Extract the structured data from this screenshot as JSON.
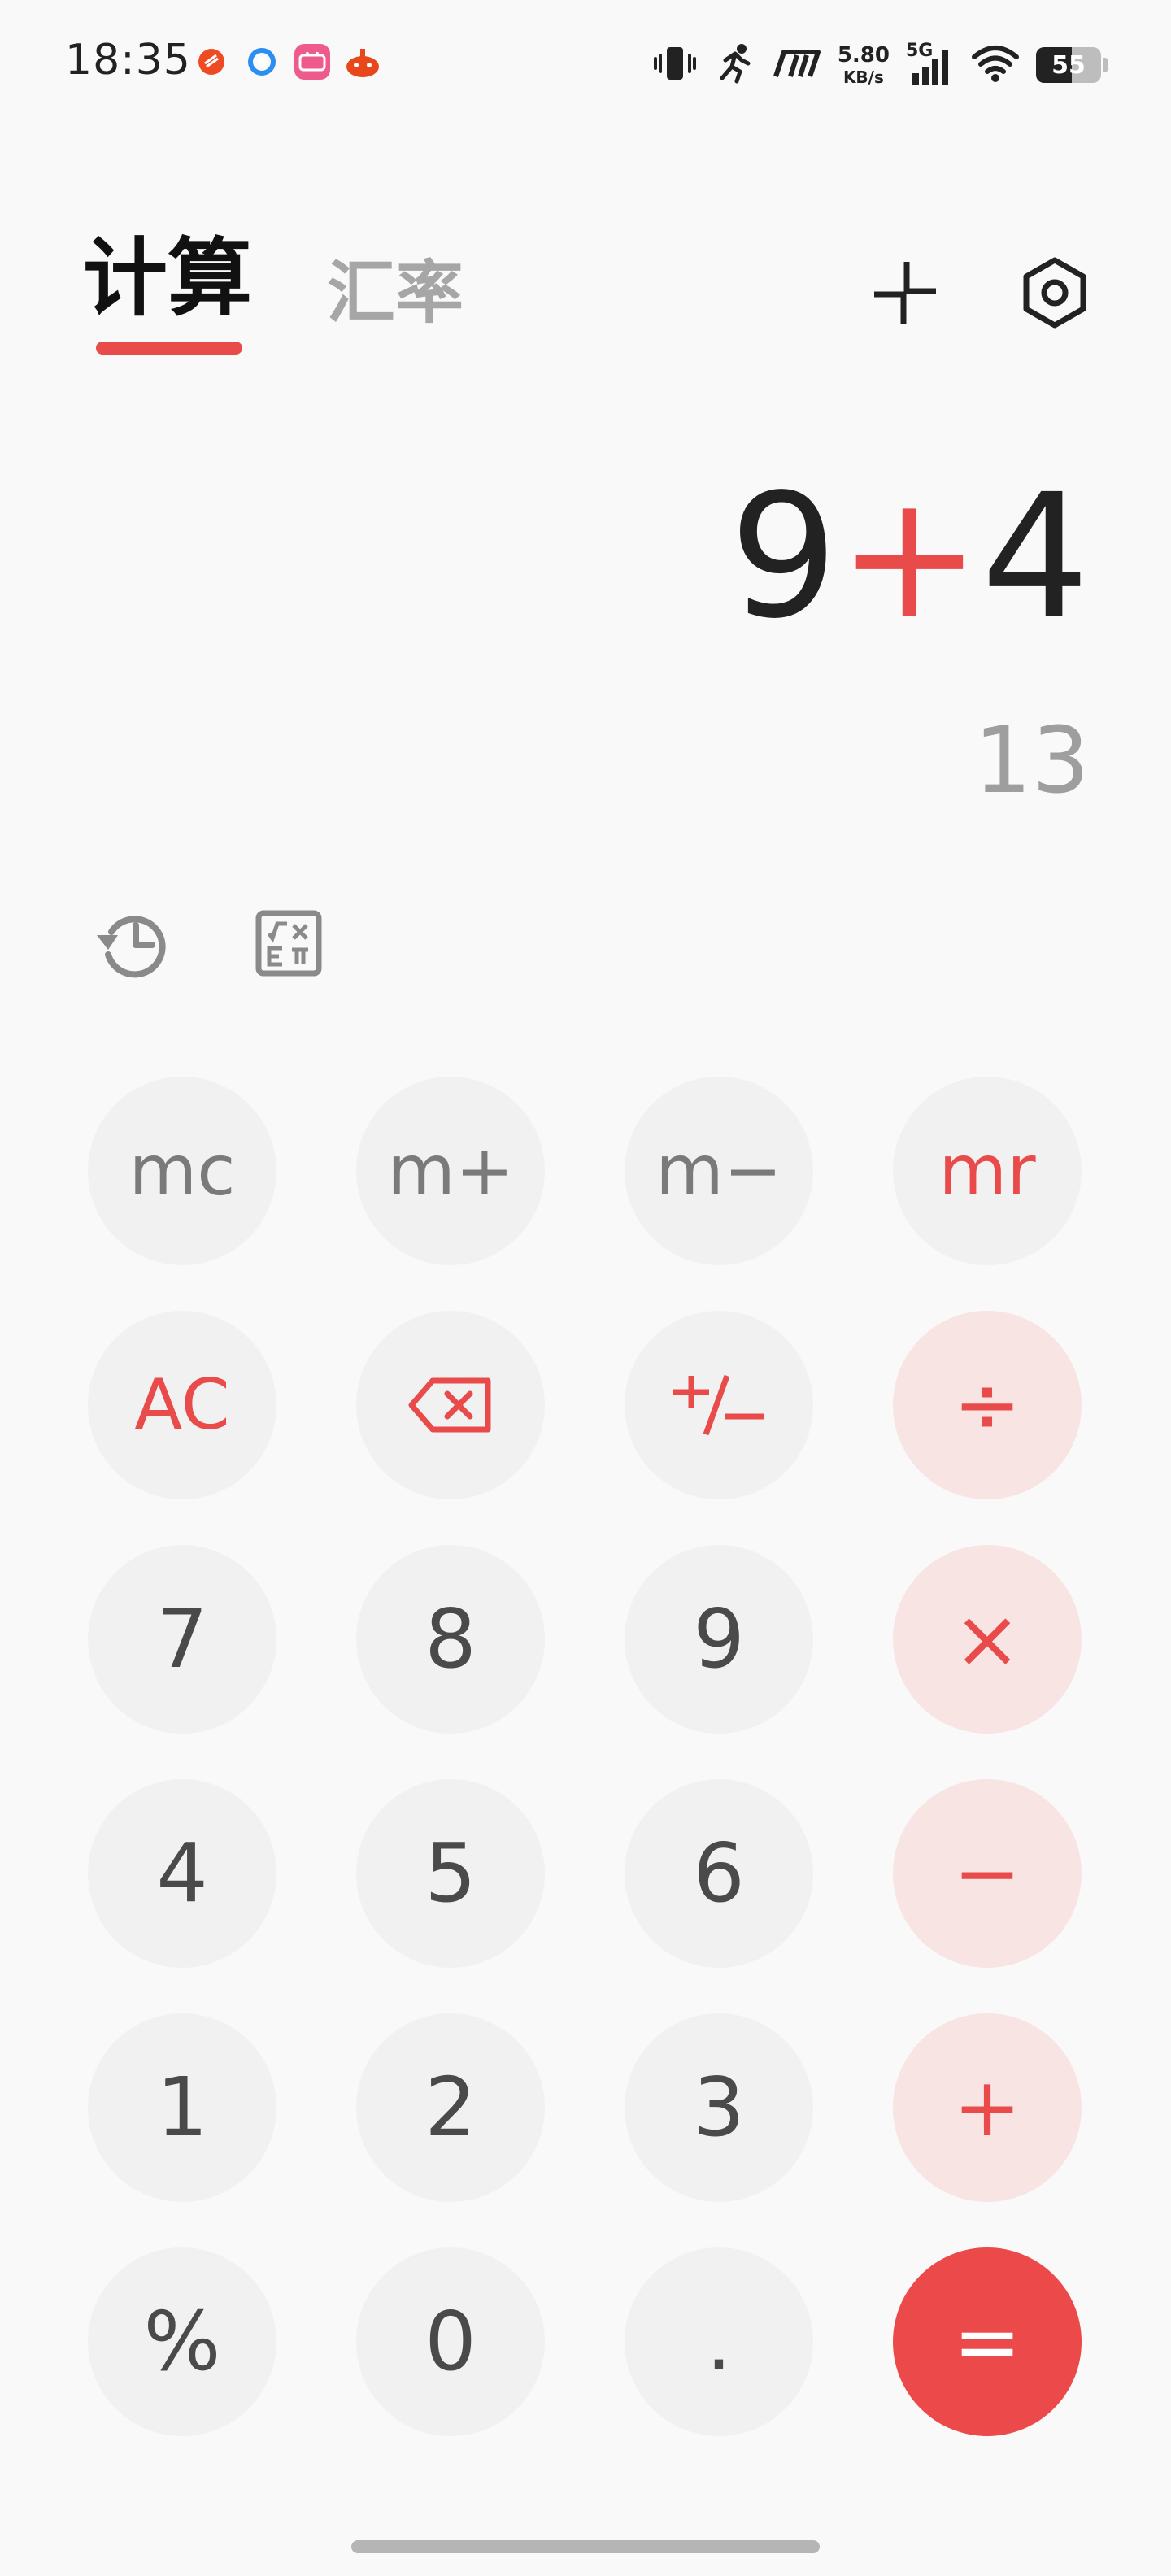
{
  "status_bar": {
    "time": "18:35",
    "net_speed_value": "5.80",
    "net_speed_unit": "KB/s",
    "network_type": "5G",
    "battery_level": "55",
    "notification_icons": [
      "sun-app-icon",
      "browser-app-icon",
      "bilibili-app-icon",
      "game-app-icon"
    ]
  },
  "header": {
    "tab_calc": "计算",
    "tab_rate": "汇率",
    "active_tab": "计算"
  },
  "display": {
    "operand1": "9",
    "operator": "+",
    "operand2": "4",
    "result": "13"
  },
  "keypad": {
    "row1": [
      "mc",
      "m+",
      "m−",
      "mr"
    ],
    "row2": [
      "AC",
      "⌫",
      "+/−",
      "÷"
    ],
    "row3": [
      "7",
      "8",
      "9",
      "×"
    ],
    "row4": [
      "4",
      "5",
      "6",
      "−"
    ],
    "row5": [
      "1",
      "2",
      "3",
      "+"
    ],
    "row6": [
      "%",
      "0",
      ".",
      "="
    ]
  },
  "colors": {
    "accent": "#e94b4b",
    "key_bg": "#f1f1f1",
    "op_key_bg": "#f9e4e4",
    "equals_bg": "#ec4a4a",
    "background": "#f9f9f9"
  }
}
